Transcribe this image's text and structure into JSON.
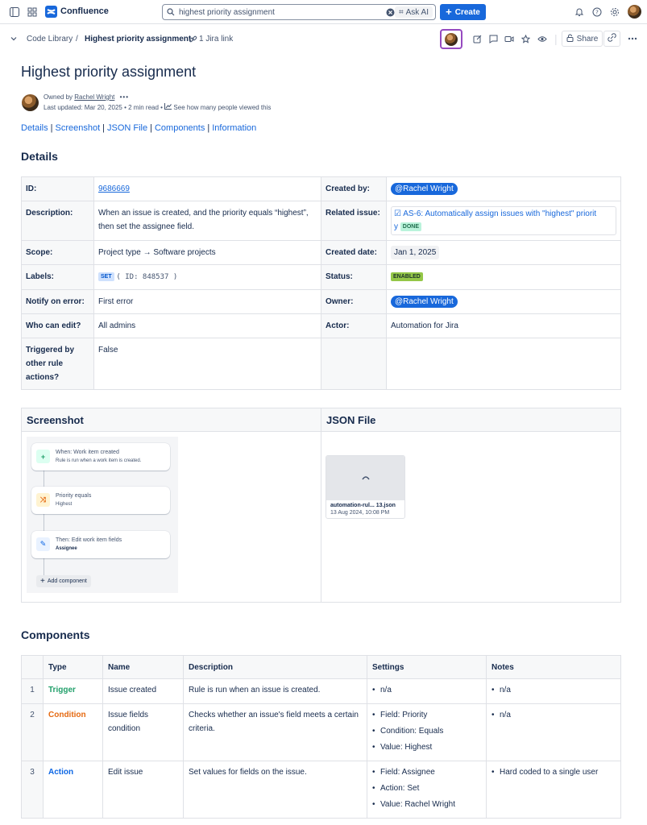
{
  "app": {
    "name": "Confluence"
  },
  "search": {
    "value": "highest priority assignment",
    "ask_ai": "Ask AI"
  },
  "topnav": {
    "create_label": "Create"
  },
  "breadcrumb": {
    "space": "Code Library",
    "separator": "/",
    "page": "Highest priority assignment",
    "jira_link": "1 Jira link"
  },
  "actions": {
    "share_label": "Share"
  },
  "page": {
    "title": "Highest priority assignment",
    "owned_prefix": "Owned by",
    "owner": "Rachel Wright",
    "last_updated": "Last updated: Mar 20, 2025",
    "read_time": "2 min read",
    "views_link": "See how many people viewed this"
  },
  "toc": [
    "Details",
    "Screenshot",
    "JSON File",
    "Components",
    "Information"
  ],
  "toc_sep": "|",
  "details": {
    "heading": "Details",
    "id_label": "ID:",
    "id_value": "9686669",
    "description_label": "Description:",
    "description_value": "When an issue is created, and the priority equals “highest”, then set the assignee field.",
    "scope_label": "Scope:",
    "scope_value": "Project type → Software projects",
    "labels_label": "Labels:",
    "labels_lozenge": "SET",
    "labels_id": "( ID: 848537 )",
    "notify_label": "Notify on error:",
    "notify_value": "First error",
    "edit_label": "Who can edit?",
    "edit_value": "All admins",
    "triggered_label": "Triggered by other rule actions?",
    "triggered_value": "False",
    "created_by_label": "Created by:",
    "created_by_value": "@Rachel Wright",
    "related_label": "Related issue:",
    "related_value": "AS-6: Automatically assign issues with \"highest\" priorit",
    "related_tail": "y",
    "related_status": "DONE",
    "created_date_label": "Created date:",
    "created_date_value": "Jan 1, 2025",
    "status_label": "Status:",
    "status_value": "ENABLED",
    "owner_label": "Owner:",
    "owner_value": "@Rachel Wright",
    "actor_label": "Actor:",
    "actor_value": "Automation for Jira"
  },
  "media": {
    "screenshot_heading": "Screenshot",
    "json_heading": "JSON File",
    "workflow": [
      {
        "title": "When: Work item created",
        "subtitle": "Rule is run when a work item is created."
      },
      {
        "title": "Priority equals",
        "subtitle": "Highest"
      },
      {
        "title": "Then: Edit work item fields",
        "subtitle": "Assignee"
      }
    ],
    "add_component": "Add component",
    "file_name": "automation-rul... 13.json",
    "file_date": "13 Aug 2024, 10:08 PM"
  },
  "components": {
    "heading": "Components",
    "columns": [
      "Type",
      "Name",
      "Description",
      "Settings",
      "Notes"
    ],
    "rows": [
      {
        "num": "1",
        "type": "Trigger",
        "name": "Issue created",
        "description": "Rule is run when an issue is created.",
        "settings": [
          "n/a"
        ],
        "notes": [
          "n/a"
        ]
      },
      {
        "num": "2",
        "type": "Condition",
        "name": "Issue fields condition",
        "description": "Checks whether an issue's field meets a certain criteria.",
        "settings": [
          "Field: Priority",
          "Condition: Equals",
          "Value: Highest"
        ],
        "notes": [
          "n/a"
        ]
      },
      {
        "num": "3",
        "type": "Action",
        "name": "Edit issue",
        "description": "Set values for fields on the issue.",
        "settings": [
          "Field: Assignee",
          "Action: Set",
          "Value: Rachel Wright"
        ],
        "notes": [
          "Hard coded to a single user"
        ]
      }
    ]
  },
  "colors": {
    "brand": "#1868db",
    "collab_border": "#964ac0",
    "trigger": "#22a06b",
    "condition": "#e56910",
    "action": "#0c66e4"
  }
}
